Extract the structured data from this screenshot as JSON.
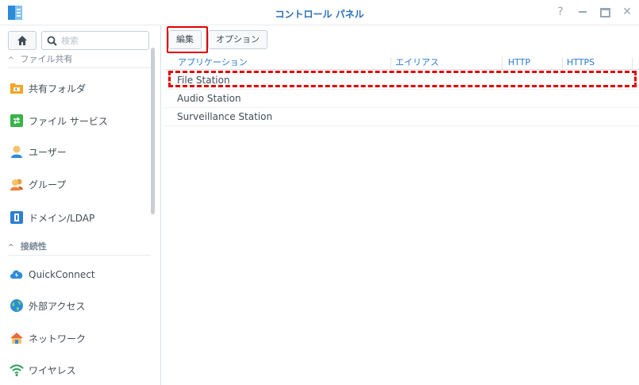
{
  "window": {
    "title": "コントロール パネル",
    "help_glyph": "?",
    "close_glyph": "✕"
  },
  "sidebar": {
    "search_placeholder": "検索",
    "sections": [
      {
        "label": "ファイル共有",
        "items": [
          "共有フォルダ",
          "ファイル サービス",
          "ユーザー",
          "グループ",
          "ドメイン/LDAP"
        ]
      },
      {
        "label": "接続性",
        "items": [
          "QuickConnect",
          "外部アクセス",
          "ネットワーク",
          "ワイヤレス"
        ]
      }
    ]
  },
  "toolbar": {
    "edit_label": "編集",
    "options_label": "オプション"
  },
  "table": {
    "columns": [
      "アプリケーション",
      "エイリアス",
      "HTTP",
      "HTTPS"
    ],
    "rows": [
      {
        "application": "File Station"
      },
      {
        "application": "Audio Station"
      },
      {
        "application": "Surveillance Station"
      }
    ]
  },
  "colors": {
    "accent": "#2c7ad0",
    "highlight": "#e00000"
  }
}
